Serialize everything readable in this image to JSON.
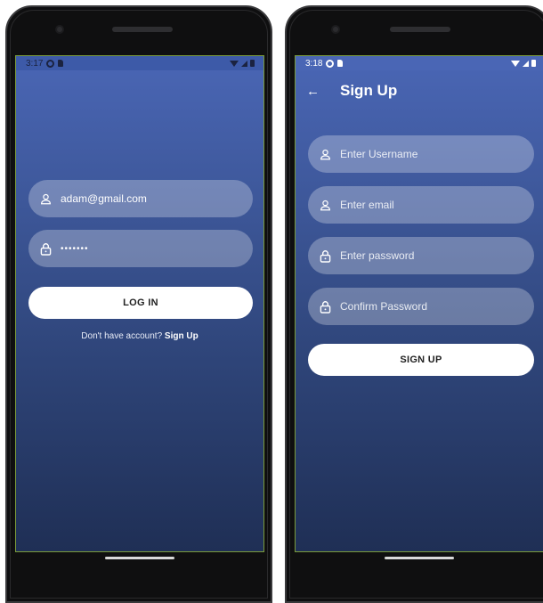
{
  "login_screen": {
    "status": {
      "time": "3:17"
    },
    "email_value": "adam@gmail.com",
    "password_value": "•••••••",
    "login_button": "LOG IN",
    "footer_text": "Don't have account?",
    "footer_link": "Sign Up"
  },
  "signup_screen": {
    "status": {
      "time": "3:18"
    },
    "title": "Sign Up",
    "back_glyph": "←",
    "username_placeholder": "Enter Username",
    "email_placeholder": "Enter email",
    "password_placeholder": "Enter password",
    "confirm_placeholder": "Confirm Password",
    "signup_button": "SIGN UP"
  },
  "icons": {
    "person": "person-icon",
    "lock": "lock-icon",
    "back": "back-arrow-icon"
  },
  "colors": {
    "gradient_top": "#4a66b5",
    "gradient_bottom": "#1f2f55",
    "field_fill": "rgba(255,255,255,0.28)",
    "button_fill": "#ffffff"
  }
}
